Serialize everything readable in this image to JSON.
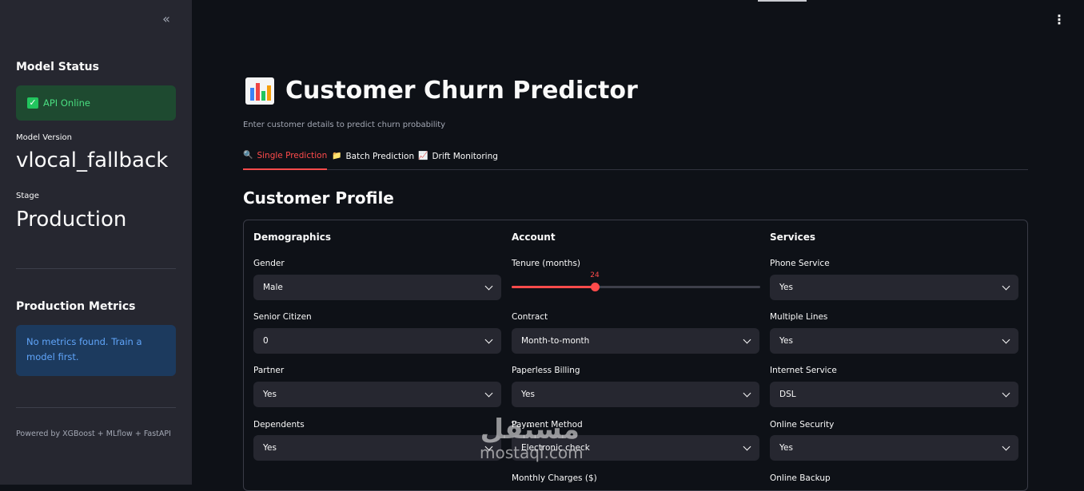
{
  "sidebar": {
    "model_status_heading": "Model Status",
    "api_status": "API Online",
    "model_version_label": "Model Version",
    "model_version": "vlocal_fallback",
    "stage_label": "Stage",
    "stage": "Production",
    "metrics_heading": "Production Metrics",
    "metrics_info": "No metrics found. Train a model first.",
    "footer": "Powered by XGBoost + MLflow + FastAPI",
    "collapse_icon": "double-chevron-left-icon"
  },
  "header": {
    "title": "Customer Churn Predictor",
    "subtitle": "Enter customer details to predict churn probability",
    "menu_icon": "kebab-menu-icon"
  },
  "tabs": [
    {
      "label": "Single Prediction",
      "icon": "magnifier-icon"
    },
    {
      "label": "Batch Prediction",
      "icon": "folder-icon"
    },
    {
      "label": "Drift Monitoring",
      "icon": "chart-up-icon"
    }
  ],
  "form": {
    "section_title": "Customer Profile",
    "demographics": {
      "heading": "Demographics",
      "gender_label": "Gender",
      "gender": "Male",
      "senior_label": "Senior Citizen",
      "senior": "0",
      "partner_label": "Partner",
      "partner": "Yes",
      "dependents_label": "Dependents",
      "dependents": "Yes"
    },
    "account": {
      "heading": "Account",
      "tenure_label": "Tenure (months)",
      "tenure": 24,
      "tenure_text": "24",
      "tenure_max": 72,
      "contract_label": "Contract",
      "contract": "Month-to-month",
      "paperless_label": "Paperless Billing",
      "paperless": "Yes",
      "payment_label": "Payment Method",
      "payment": "Electronic check",
      "monthly_label": "Monthly Charges ($)"
    },
    "services": {
      "heading": "Services",
      "phone_label": "Phone Service",
      "phone": "Yes",
      "multiple_label": "Multiple Lines",
      "multiple": "Yes",
      "internet_label": "Internet Service",
      "internet": "DSL",
      "security_label": "Online Security",
      "security": "Yes",
      "backup_label": "Online Backup"
    }
  },
  "watermark": {
    "arabic": "مستقل",
    "latin": "mostaql.com"
  },
  "colors": {
    "accent": "#ff4b4b",
    "success": "#4ade80",
    "info": "#60a5fa",
    "sidebar": "#262730",
    "background": "#0e1117"
  }
}
